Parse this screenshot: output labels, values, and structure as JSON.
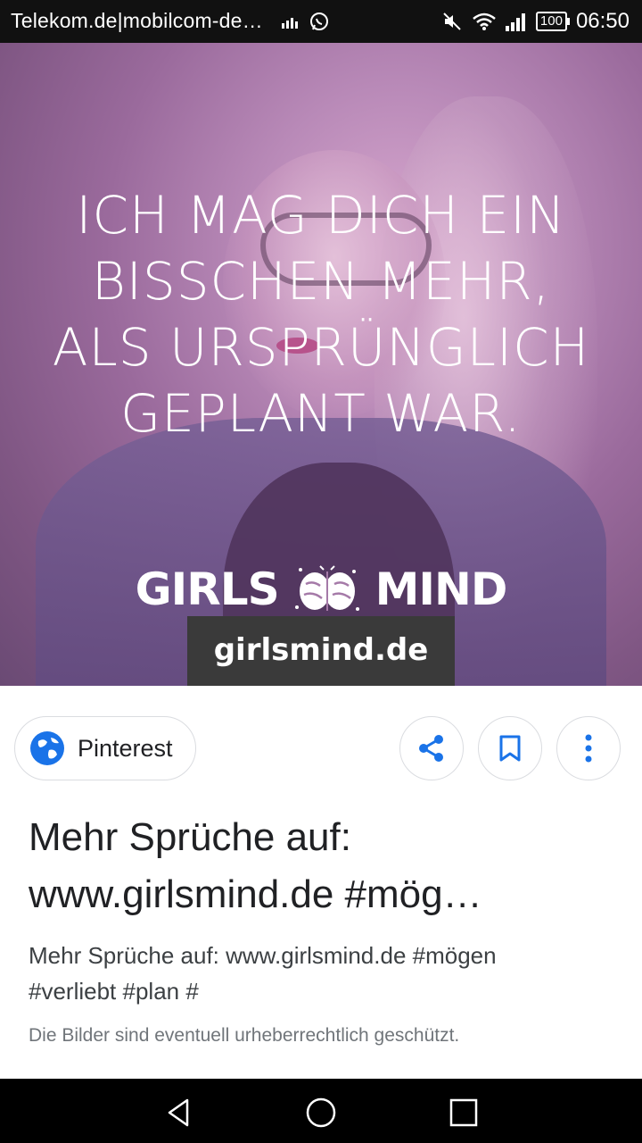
{
  "status_bar": {
    "carrier": "Telekom.de|mobilcom-de…",
    "battery": "100",
    "time": "06:50",
    "icons": [
      "signal-bars-icon",
      "whatsapp-icon",
      "mute-icon",
      "wifi-icon",
      "cell-signal-icon",
      "battery-icon"
    ]
  },
  "image": {
    "quote_lines": [
      "ICH MAG DICH EIN",
      "BISSCHEN MEHR,",
      "ALS URSPRÜNGLICH",
      "GEPLANT WAR."
    ],
    "brand_left": "GIRLS",
    "brand_right": "MIND",
    "url": "girlsmind.de"
  },
  "actions": {
    "source_label": "Pinterest",
    "buttons": [
      "share-icon",
      "bookmark-icon",
      "more-vert-icon"
    ]
  },
  "result": {
    "title_lines": [
      "Mehr Sprüche auf:",
      "www.girlsmind.de #mög…"
    ],
    "description_lines": [
      "Mehr Sprüche auf: www.girlsmind.de #mögen",
      "#verliebt #plan #"
    ],
    "copyright": "Die Bilder sind eventuell urheberrechtlich geschützt."
  },
  "nav": [
    "back-icon",
    "home-icon",
    "recents-icon"
  ],
  "colors": {
    "accent_blue": "#1a73e8",
    "overlay_purple": "#a57aa8",
    "url_box": "#3a3a3a"
  }
}
